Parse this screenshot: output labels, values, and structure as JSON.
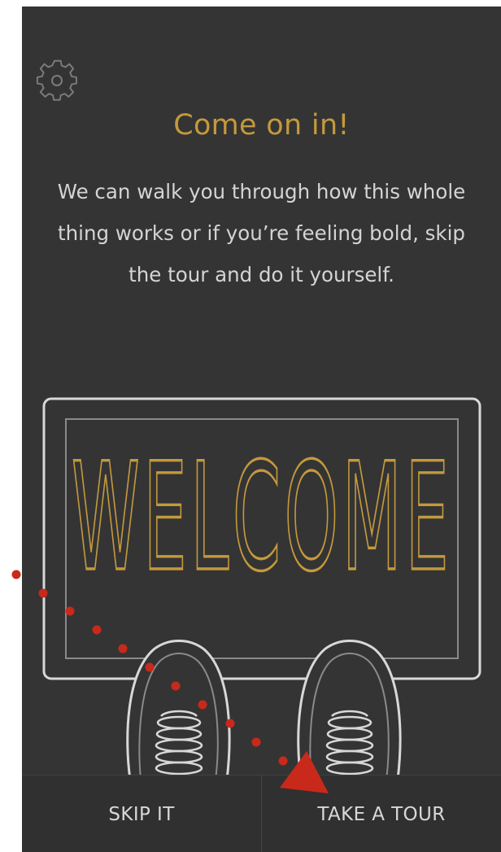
{
  "header": {
    "settings_icon": "gear-icon"
  },
  "intro": {
    "title": "Come on in!",
    "body": "We can walk you through how this whole thing works or if you’re feeling bold, skip the tour and do it yourself."
  },
  "mat": {
    "label": "WELCOME"
  },
  "actions": {
    "skip_label": "SKIP IT",
    "tour_label": "TAKE A TOUR"
  },
  "colors": {
    "background": "#343434",
    "accent": "#c4993d",
    "text": "#d4d4d4",
    "annotation": "#c8291b"
  }
}
